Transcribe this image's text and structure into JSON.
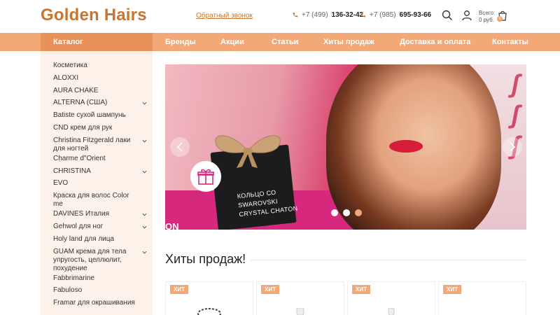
{
  "header": {
    "logo": "Golden Hairs",
    "callback": "Обратный звонок",
    "phones": [
      {
        "code": "+7 (499)",
        "number": "136-32-42"
      },
      {
        "code": "+7 (985)",
        "number": "695-93-66"
      }
    ],
    "cart": {
      "line1": "Всего:",
      "line2": "0 руб.",
      "count": "0"
    }
  },
  "nav": {
    "catalog": "Каталог",
    "items": [
      "Бренды",
      "Акции",
      "Статьи",
      "Хиты продаж",
      "Доставка и оплата",
      "Контакты"
    ]
  },
  "sidebar": {
    "items": [
      {
        "label": "Косметика",
        "has_children": false
      },
      {
        "label": "ALOXXI",
        "has_children": false
      },
      {
        "label": "AURA CHAKE",
        "has_children": false
      },
      {
        "label": "ALTERNA (США)",
        "has_children": true
      },
      {
        "label": "Batiste сухой шампунь",
        "has_children": false
      },
      {
        "label": "CND крем для рук",
        "has_children": false
      },
      {
        "label": "Christina Fitzgerald лаки для ногтей",
        "has_children": true
      },
      {
        "label": "Charme d\"Orient",
        "has_children": false
      },
      {
        "label": "CHRISTINA",
        "has_children": true
      },
      {
        "label": "EVO",
        "has_children": false
      },
      {
        "label": "Краска для волос Color me",
        "has_children": false
      },
      {
        "label": "DAVINES Италия",
        "has_children": true
      },
      {
        "label": "Gehwol для ног",
        "has_children": true
      },
      {
        "label": "Holy land для лица",
        "has_children": false
      },
      {
        "label": "GUAM крема для тела упругость, целлюлит, похудение",
        "has_children": true
      },
      {
        "label": "Fabbrimarine",
        "has_children": false
      },
      {
        "label": "Fabuloso",
        "has_children": false
      },
      {
        "label": "Framar для окрашивания",
        "has_children": false
      }
    ]
  },
  "banner": {
    "box_text_line1": "КОЛЬЦО СО",
    "box_text_line2": "SWAROVSKI",
    "box_text_line3": "CRYSTAL CHATON",
    "corner_text": "ON",
    "slides": 3,
    "active_slide": 2
  },
  "hits": {
    "title": "Хиты продаж!",
    "badge": "ХИТ",
    "cards": 4
  },
  "colors": {
    "brand": "#c7752f",
    "nav_bg": "#f2a877",
    "catalog_bg": "#e8925a",
    "sidebar_bg": "#fdf2e9"
  }
}
